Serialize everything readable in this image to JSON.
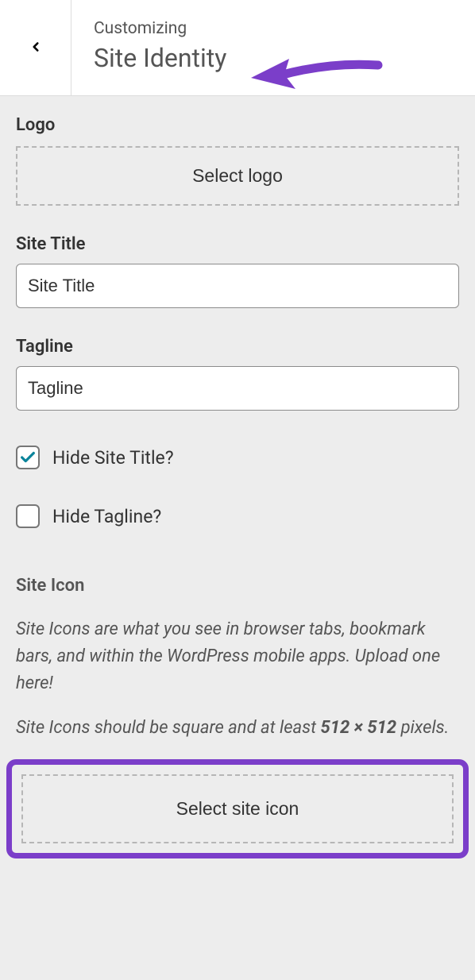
{
  "header": {
    "label": "Customizing",
    "title": "Site Identity"
  },
  "logo": {
    "label": "Logo",
    "button": "Select logo"
  },
  "site_title": {
    "label": "Site Title",
    "value": "Site Title"
  },
  "tagline": {
    "label": "Tagline",
    "value": "Tagline"
  },
  "hide_title": {
    "label": "Hide Site Title?",
    "checked": true
  },
  "hide_tagline": {
    "label": "Hide Tagline?",
    "checked": false
  },
  "site_icon": {
    "heading": "Site Icon",
    "desc1": "Site Icons are what you see in browser tabs, bookmark bars, and within the WordPress mobile apps. Upload one here!",
    "desc2_pre": "Site Icons should be square and at least ",
    "desc2_bold": "512 × 512",
    "desc2_post": " pixels.",
    "button": "Select site icon"
  }
}
